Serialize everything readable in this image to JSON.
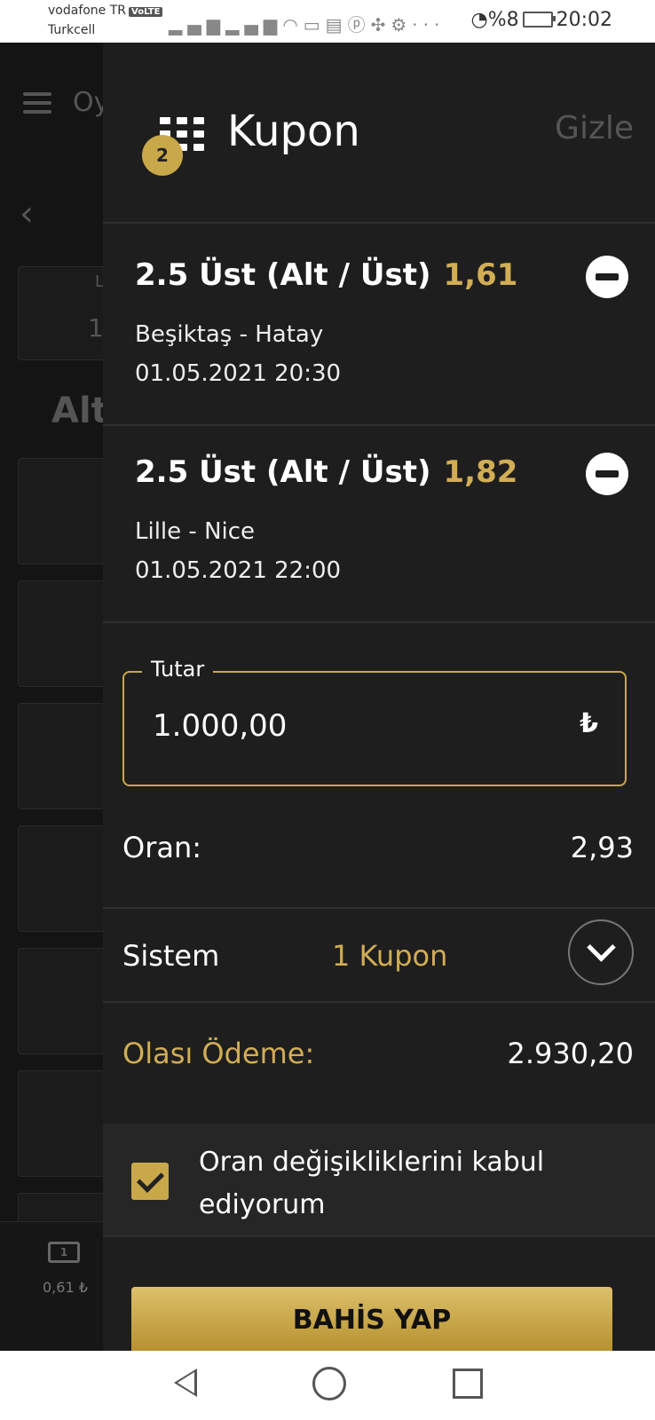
{
  "status_bar": {
    "carrier1": "vodafone TR",
    "volte": "VoLTE",
    "carrier2": "Turkcell",
    "battery": "%8",
    "time": "20:02"
  },
  "background_app": {
    "title_partial": "Oy",
    "section_partial": "Alt",
    "card_label_partial": "L",
    "card_value_partial": "1",
    "balance": "0,61 ₺"
  },
  "coupon": {
    "title": "Kupon",
    "count_badge": "2",
    "hide_label": "Gizle",
    "bets": [
      {
        "market": "2.5 Üst  (Alt / Üst)",
        "odd": "1,61",
        "match": "Beşiktaş - Hatay",
        "datetime": "01.05.2021 20:30"
      },
      {
        "market": "2.5 Üst  (Alt / Üst)",
        "odd": "1,82",
        "match": "Lille - Nice",
        "datetime": "01.05.2021 22:00"
      }
    ],
    "amount_label": "Tutar",
    "amount_value": "1.000,00",
    "currency": "₺",
    "odds_label": "Oran:",
    "odds_value": "2,93",
    "system_label": "Sistem",
    "system_value": "1 Kupon",
    "payout_label": "Olası Ödeme:",
    "payout_value": "2.930,20",
    "accept_text": "Oran değişikliklerini kabul ediyorum",
    "accept_checked": true,
    "bet_button": "BAHİS YAP"
  },
  "colors": {
    "accent": "#c9a84a",
    "panel": "#1e1e1e"
  }
}
